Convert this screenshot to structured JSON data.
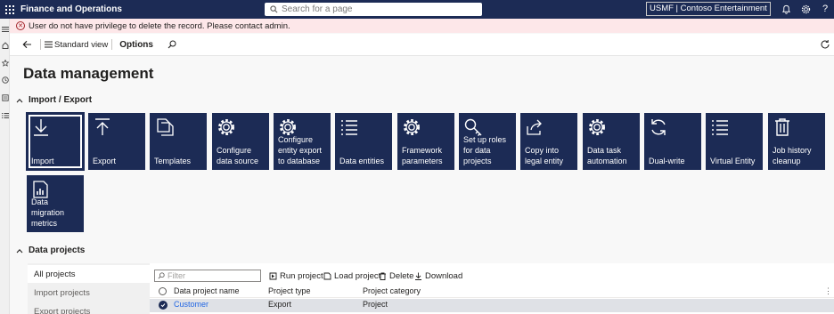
{
  "app": {
    "title": "Finance and Operations"
  },
  "search": {
    "placeholder": "Search for a page"
  },
  "company": {
    "label": "USMF | Contoso Entertainment Syste..."
  },
  "error": {
    "message": "User do not have privilege to delete the record. Please contact admin."
  },
  "actionbar": {
    "view_label": "Standard view",
    "options_label": "Options"
  },
  "page": {
    "title": "Data management"
  },
  "import_export": {
    "heading": "Import / Export",
    "tiles": [
      {
        "label": "Import",
        "icon": "download-icon"
      },
      {
        "label": "Export",
        "icon": "upload-icon"
      },
      {
        "label": "Templates",
        "icon": "copy-icon"
      },
      {
        "label": "Configure data source",
        "icon": "gear-icon"
      },
      {
        "label": "Configure entity export to database",
        "icon": "gear-icon"
      },
      {
        "label": "Data entities",
        "icon": "list-icon"
      },
      {
        "label": "Framework parameters",
        "icon": "gear-icon"
      },
      {
        "label": "Set up roles for data projects",
        "icon": "key-icon"
      },
      {
        "label": "Copy into legal entity",
        "icon": "share-icon"
      },
      {
        "label": "Data task automation",
        "icon": "gear-icon"
      },
      {
        "label": "Dual-write",
        "icon": "sync-icon"
      },
      {
        "label": "Virtual Entity",
        "icon": "list-icon"
      },
      {
        "label": "Job history cleanup",
        "icon": "trash-icon"
      },
      {
        "label": "Data migration metrics",
        "icon": "report-icon"
      }
    ]
  },
  "data_projects": {
    "heading": "Data projects",
    "nav": [
      "All projects",
      "Import projects",
      "Export projects"
    ],
    "filter_placeholder": "Filter",
    "toolbar": {
      "run": "Run project",
      "load": "Load project",
      "delete": "Delete",
      "download": "Download"
    },
    "columns": [
      "Data project name",
      "Project type",
      "Project category"
    ],
    "rows": [
      {
        "name": "Customer",
        "type": "Export",
        "category": "Project"
      }
    ]
  },
  "colors": {
    "nav": "#1c2b55",
    "tile": "#1c2b55",
    "error_bg": "#fde7e9",
    "link": "#2266e3"
  }
}
